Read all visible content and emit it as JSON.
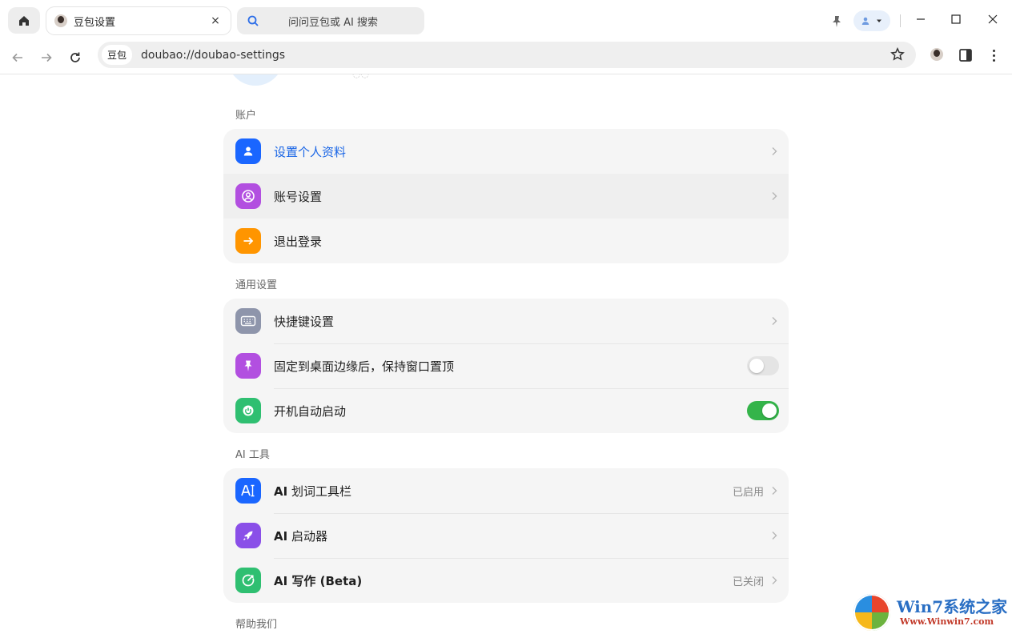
{
  "browser": {
    "tab_title": "豆包设置",
    "tab_close": "×",
    "search_pill_text": "问问豆包或 AI 搜索",
    "site_chip": "豆包",
    "url": "doubao://doubao-settings"
  },
  "sections": [
    {
      "title": "账户",
      "items": [
        {
          "label": "设置个人资料",
          "icon": "person-icon",
          "color": "#1a66ff"
        },
        {
          "label": "账号设置",
          "icon": "account-circle-icon",
          "color": "#b24fe0"
        },
        {
          "label": "退出登录",
          "icon": "arrow-right-icon",
          "color": "#ff9500"
        }
      ]
    },
    {
      "title": "通用设置",
      "items": [
        {
          "label": "快捷键设置",
          "icon": "keyboard-icon",
          "color": "#8e95ab"
        },
        {
          "label": "固定到桌面边缘后，保持窗口置顶",
          "icon": "pin-icon",
          "color": "#b24fe0",
          "toggle": "off"
        },
        {
          "label": "开机自动启动",
          "icon": "power-icon",
          "color": "#2fbf71",
          "toggle": "on"
        }
      ]
    },
    {
      "title": "AI 工具",
      "items": [
        {
          "label_bold": "AI",
          "label": " 划词工具栏",
          "icon": "text-cursor-icon",
          "color": "#1a66ff",
          "status": "已启用"
        },
        {
          "label_bold": "AI",
          "label": " 启动器",
          "icon": "rocket-icon",
          "color": "#8a4fe8"
        },
        {
          "label_bold": "AI 写作 (Beta)",
          "label": "",
          "icon": "compass-icon",
          "color": "#2fbf71",
          "status": "已关闭"
        }
      ]
    },
    {
      "title": "帮助我们"
    }
  ],
  "watermark": {
    "line1": "Win7系统之家",
    "line2": "Www.Winwin7.com"
  }
}
